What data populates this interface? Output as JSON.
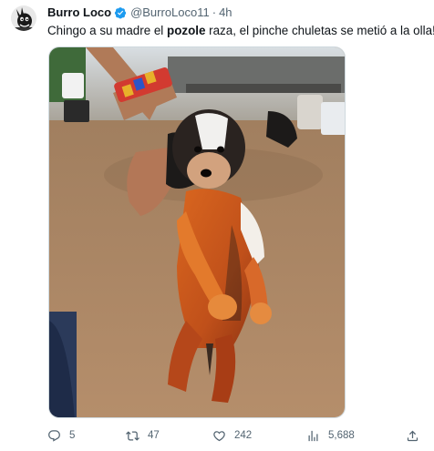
{
  "author": {
    "display_name": "Burro Loco",
    "handle": "@BurroLoco11",
    "separator": "·",
    "time": "4h",
    "verified_color": "#1d9bf0",
    "avatar_icon": "burro-loco-avatar"
  },
  "tweet": {
    "text_before": "Chingo a su madre el ",
    "text_bold": "pozole",
    "text_after": " raza,  el pinche chuletas se metió a la olla!"
  },
  "media": {
    "icon": "photo-of-puppy-in-red-broth"
  },
  "actions": {
    "reply_count": "5",
    "retweet_count": "47",
    "like_count": "242",
    "view_count": "5,688",
    "reply_icon": "reply-icon",
    "retweet_icon": "retweet-icon",
    "like_icon": "heart-icon",
    "views_icon": "views-icon",
    "share_icon": "share-icon"
  },
  "colors": {
    "text_primary": "#0f1419",
    "text_secondary": "#536471",
    "accent": "#1d9bf0",
    "border": "#cfd9de"
  }
}
